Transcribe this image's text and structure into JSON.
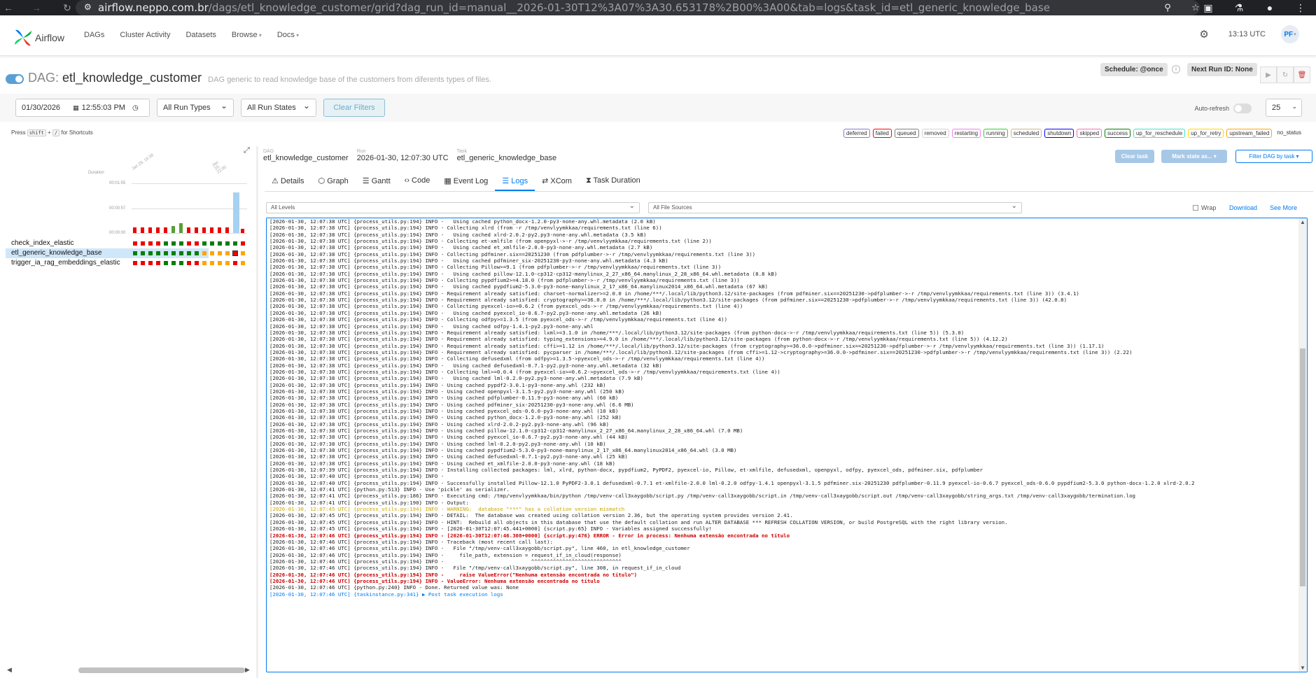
{
  "browser": {
    "url_host": "airflow.neppo.com.br",
    "url_path": "/dags/etl_knowledge_customer/grid?dag_run_id=manual__2026-01-30T12%3A07%3A30.653178%2B00%3A00&tab=logs&task_id=etl_generic_knowledge_base"
  },
  "app": {
    "logo": "Airflow",
    "menu": [
      "DAGs",
      "Cluster Activity",
      "Datasets",
      "Browse",
      "Docs"
    ],
    "time": "13:13 UTC",
    "user": "PF"
  },
  "dag": {
    "prefix": "DAG:",
    "name": "etl_knowledge_customer",
    "description": "DAG generic to read knowledge base of the customers from diferents types of files.",
    "schedule": "Schedule: @once",
    "next_run": "Next Run ID: None"
  },
  "filters": {
    "date": "01/30/2026",
    "time": "12:55:03 PM",
    "run_types": "All Run Types",
    "run_states": "All Run States",
    "clear": "Clear Filters",
    "auto_refresh": "Auto-refresh",
    "page_size": "25"
  },
  "shortcut": {
    "press": "Press",
    "key1": "shift",
    "key2": "/",
    "text": "for Shortcuts"
  },
  "legend": [
    {
      "label": "deferred",
      "color": "#9370db"
    },
    {
      "label": "failed",
      "color": "#ff0000"
    },
    {
      "label": "queued",
      "color": "#808080"
    },
    {
      "label": "removed",
      "color": "#d3d3d3"
    },
    {
      "label": "restarting",
      "color": "#ee82ee"
    },
    {
      "label": "running",
      "color": "#32cd32"
    },
    {
      "label": "scheduled",
      "color": "#d2b48c"
    },
    {
      "label": "shutdown",
      "color": "#0000ff"
    },
    {
      "label": "skipped",
      "color": "#ff69b4"
    },
    {
      "label": "success",
      "color": "#008000"
    },
    {
      "label": "up_for_reschedule",
      "color": "#40e0d0"
    },
    {
      "label": "up_for_retry",
      "color": "#ffd700"
    },
    {
      "label": "upstream_failed",
      "color": "#ffa500"
    },
    {
      "label": "no_status",
      "color": "#ffffff"
    }
  ],
  "grid": {
    "duration_label": "Duration",
    "yticks": [
      "00:01:55",
      "00:00:57",
      "00:00:00"
    ],
    "date_labels": [
      "Jan 28, 16:38",
      "Jan 29, 22:00"
    ],
    "tasks": [
      "check_index_elastic",
      "etl_generic_knowledge_base",
      "trigger_ia_rag_embeddings_elastic"
    ]
  },
  "detail": {
    "dag_label": "DAG",
    "dag_value": "etl_knowledge_customer",
    "run_label": "Run",
    "run_value": "2026-01-30, 12:07:30 UTC",
    "task_label": "Task",
    "task_value": "etl_generic_knowledge_base",
    "clear_task": "Clear task",
    "mark_state": "Mark state as...",
    "filter_dag": "Filter DAG by task",
    "tabs": [
      "Details",
      "Graph",
      "Gantt",
      "Code",
      "Event Log",
      "Logs",
      "XCom",
      "Task Duration"
    ],
    "tab_icons": [
      "warning-icon",
      "graph-icon",
      "gantt-icon",
      "code-icon",
      "calendar-icon",
      "list-icon",
      "xcom-icon",
      "hourglass-icon"
    ],
    "active_tab": "Logs",
    "levels": "All Levels",
    "sources": "All File Sources",
    "wrap": "Wrap",
    "download": "Download",
    "see_more": "See More"
  },
  "log_lines": [
    {
      "t": "[2026-01-30, 12:07:38 UTC] {process_utils.py:194} INFO -   Using cached python_docx-1.2.0-py3-none-any.whl.metadata (2.0 kB)",
      "c": ""
    },
    {
      "t": "[2026-01-30, 12:07:38 UTC] {process_utils.py:194} INFO - Collecting xlrd (from -r /tmp/venvlyymkkaa/requirements.txt (line 6))",
      "c": ""
    },
    {
      "t": "[2026-01-30, 12:07:38 UTC] {process_utils.py:194} INFO -   Using cached xlrd-2.0.2-py2.py3-none-any.whl.metadata (3.5 kB)",
      "c": ""
    },
    {
      "t": "[2026-01-30, 12:07:38 UTC] {process_utils.py:194} INFO - Collecting et-xmlfile (from openpyxl->-r /tmp/venvlyymkkaa/requirements.txt (line 2))",
      "c": ""
    },
    {
      "t": "[2026-01-30, 12:07:38 UTC] {process_utils.py:194} INFO -   Using cached et_xmlfile-2.0.0-py3-none-any.whl.metadata (2.7 kB)",
      "c": ""
    },
    {
      "t": "[2026-01-30, 12:07:38 UTC] {process_utils.py:194} INFO - Collecting pdfminer.six==20251230 (from pdfplumber->-r /tmp/venvlyymkkaa/requirements.txt (line 3))",
      "c": ""
    },
    {
      "t": "[2026-01-30, 12:07:38 UTC] {process_utils.py:194} INFO -   Using cached pdfminer_six-20251230-py3-none-any.whl.metadata (4.3 kB)",
      "c": ""
    },
    {
      "t": "[2026-01-30, 12:07:38 UTC] {process_utils.py:194} INFO - Collecting Pillow>=9.1 (from pdfplumber->-r /tmp/venvlyymkkaa/requirements.txt (line 3))",
      "c": ""
    },
    {
      "t": "[2026-01-30, 12:07:38 UTC] {process_utils.py:194} INFO -   Using cached pillow-12.1.0-cp312-cp312-manylinux_2_27_x86_64.manylinux_2_28_x86_64.whl.metadata (8.8 kB)",
      "c": ""
    },
    {
      "t": "[2026-01-30, 12:07:38 UTC] {process_utils.py:194} INFO - Collecting pypdfium2>=4.18.0 (from pdfplumber->-r /tmp/venvlyymkkaa/requirements.txt (line 3))",
      "c": ""
    },
    {
      "t": "[2026-01-30, 12:07:38 UTC] {process_utils.py:194} INFO -   Using cached pypdfium2-5.3.0-py3-none-manylinux_2_17_x86_64.manylinux2014_x86_64.whl.metadata (67 kB)",
      "c": ""
    },
    {
      "t": "[2026-01-30, 12:07:38 UTC] {process_utils.py:194} INFO - Requirement already satisfied: charset-normalizer>=2.0.0 in /home/***/.local/lib/python3.12/site-packages (from pdfminer.six==20251230->pdfplumber->-r /tmp/venvlyymkkaa/requirements.txt (line 3)) (3.4.1)",
      "c": ""
    },
    {
      "t": "[2026-01-30, 12:07:38 UTC] {process_utils.py:194} INFO - Requirement already satisfied: cryptography>=36.0.0 in /home/***/.local/lib/python3.12/site-packages (from pdfminer.six==20251230->pdfplumber->-r /tmp/venvlyymkkaa/requirements.txt (line 3)) (42.0.8)",
      "c": ""
    },
    {
      "t": "[2026-01-30, 12:07:38 UTC] {process_utils.py:194} INFO - Collecting pyexcel-io>=0.6.2 (from pyexcel_ods->-r /tmp/venvlyymkkaa/requirements.txt (line 4))",
      "c": ""
    },
    {
      "t": "[2026-01-30, 12:07:38 UTC] {process_utils.py:194} INFO -   Using cached pyexcel_io-0.6.7-py2.py3-none-any.whl.metadata (26 kB)",
      "c": ""
    },
    {
      "t": "[2026-01-30, 12:07:38 UTC] {process_utils.py:194} INFO - Collecting odfpy>=1.3.5 (from pyexcel_ods->-r /tmp/venvlyymkkaa/requirements.txt (line 4))",
      "c": ""
    },
    {
      "t": "[2026-01-30, 12:07:38 UTC] {process_utils.py:194} INFO -   Using cached odfpy-1.4.1-py2.py3-none-any.whl",
      "c": ""
    },
    {
      "t": "[2026-01-30, 12:07:38 UTC] {process_utils.py:194} INFO - Requirement already satisfied: lxml>=3.1.0 in /home/***/.local/lib/python3.12/site-packages (from python-docx->-r /tmp/venvlyymkkaa/requirements.txt (line 5)) (5.3.0)",
      "c": ""
    },
    {
      "t": "[2026-01-30, 12:07:38 UTC] {process_utils.py:194} INFO - Requirement already satisfied: typing_extensions>=4.9.0 in /home/***/.local/lib/python3.12/site-packages (from python-docx->-r /tmp/venvlyymkkaa/requirements.txt (line 5)) (4.12.2)",
      "c": ""
    },
    {
      "t": "[2026-01-30, 12:07:38 UTC] {process_utils.py:194} INFO - Requirement already satisfied: cffi>=1.12 in /home/***/.local/lib/python3.12/site-packages (from cryptography>=36.0.0->pdfminer.six==20251230->pdfplumber->-r /tmp/venvlyymkkaa/requirements.txt (line 3)) (1.17.1)",
      "c": ""
    },
    {
      "t": "[2026-01-30, 12:07:38 UTC] {process_utils.py:194} INFO - Requirement already satisfied: pycparser in /home/***/.local/lib/python3.12/site-packages (from cffi>=1.12->cryptography>=36.0.0->pdfminer.six==20251230->pdfplumber->-r /tmp/venvlyymkkaa/requirements.txt (line 3)) (2.22)",
      "c": ""
    },
    {
      "t": "[2026-01-30, 12:07:38 UTC] {process_utils.py:194} INFO - Collecting defusedxml (from odfpy>=1.3.5->pyexcel_ods->-r /tmp/venvlyymkkaa/requirements.txt (line 4))",
      "c": ""
    },
    {
      "t": "[2026-01-30, 12:07:38 UTC] {process_utils.py:194} INFO -   Using cached defusedxml-0.7.1-py2.py3-none-any.whl.metadata (32 kB)",
      "c": ""
    },
    {
      "t": "[2026-01-30, 12:07:38 UTC] {process_utils.py:194} INFO - Collecting lml>=0.0.4 (from pyexcel-io>=0.6.2->pyexcel_ods->-r /tmp/venvlyymkkaa/requirements.txt (line 4))",
      "c": ""
    },
    {
      "t": "[2026-01-30, 12:07:38 UTC] {process_utils.py:194} INFO -   Using cached lml-0.2.0-py2.py3-none-any.whl.metadata (7.9 kB)",
      "c": ""
    },
    {
      "t": "[2026-01-30, 12:07:38 UTC] {process_utils.py:194} INFO - Using cached pypdf2-3.0.1-py3-none-any.whl (232 kB)",
      "c": ""
    },
    {
      "t": "[2026-01-30, 12:07:38 UTC] {process_utils.py:194} INFO - Using cached openpyxl-3.1.5-py2.py3-none-any.whl (250 kB)",
      "c": ""
    },
    {
      "t": "[2026-01-30, 12:07:38 UTC] {process_utils.py:194} INFO - Using cached pdfplumber-0.11.9-py3-none-any.whl (60 kB)",
      "c": ""
    },
    {
      "t": "[2026-01-30, 12:07:38 UTC] {process_utils.py:194} INFO - Using cached pdfminer_six-20251230-py3-none-any.whl (6.6 MB)",
      "c": ""
    },
    {
      "t": "[2026-01-30, 12:07:38 UTC] {process_utils.py:194} INFO - Using cached pyexcel_ods-0.6.0-py3-none-any.whl (10 kB)",
      "c": ""
    },
    {
      "t": "[2026-01-30, 12:07:38 UTC] {process_utils.py:194} INFO - Using cached python_docx-1.2.0-py3-none-any.whl (252 kB)",
      "c": ""
    },
    {
      "t": "[2026-01-30, 12:07:38 UTC] {process_utils.py:194} INFO - Using cached xlrd-2.0.2-py2.py3-none-any.whl (96 kB)",
      "c": ""
    },
    {
      "t": "[2026-01-30, 12:07:38 UTC] {process_utils.py:194} INFO - Using cached pillow-12.1.0-cp312-cp312-manylinux_2_27_x86_64.manylinux_2_28_x86_64.whl (7.0 MB)",
      "c": ""
    },
    {
      "t": "[2026-01-30, 12:07:38 UTC] {process_utils.py:194} INFO - Using cached pyexcel_io-0.6.7-py2.py3-none-any.whl (44 kB)",
      "c": ""
    },
    {
      "t": "[2026-01-30, 12:07:38 UTC] {process_utils.py:194} INFO - Using cached lml-0.2.0-py2.py3-none-any.whl (10 kB)",
      "c": ""
    },
    {
      "t": "[2026-01-30, 12:07:38 UTC] {process_utils.py:194} INFO - Using cached pypdfium2-5.3.0-py3-none-manylinux_2_17_x86_64.manylinux2014_x86_64.whl (3.0 MB)",
      "c": ""
    },
    {
      "t": "[2026-01-30, 12:07:38 UTC] {process_utils.py:194} INFO - Using cached defusedxml-0.7.1-py2.py3-none-any.whl (25 kB)",
      "c": ""
    },
    {
      "t": "[2026-01-30, 12:07:38 UTC] {process_utils.py:194} INFO - Using cached et_xmlfile-2.0.0-py3-none-any.whl (18 kB)",
      "c": ""
    },
    {
      "t": "[2026-01-30, 12:07:39 UTC] {process_utils.py:194} INFO - Installing collected packages: lml, xlrd, python-docx, pypdfium2, PyPDF2, pyexcel-io, Pillow, et-xmlfile, defusedxml, openpyxl, odfpy, pyexcel_ods, pdfminer.six, pdfplumber",
      "c": ""
    },
    {
      "t": "[2026-01-30, 12:07:40 UTC] {process_utils.py:194} INFO - ",
      "c": ""
    },
    {
      "t": "[2026-01-30, 12:07:40 UTC] {process_utils.py:194} INFO - Successfully installed Pillow-12.1.0 PyPDF2-3.0.1 defusedxml-0.7.1 et-xmlfile-2.0.0 lml-0.2.0 odfpy-1.4.1 openpyxl-3.1.5 pdfminer.six-20251230 pdfplumber-0.11.9 pyexcel-io-0.6.7 pyexcel_ods-0.6.0 pypdfium2-5.3.0 python-docx-1.2.0 xlrd-2.0.2",
      "c": ""
    },
    {
      "t": "[2026-01-30, 12:07:41 UTC] {python.py:513} INFO - Use 'pickle' as serializer.",
      "c": ""
    },
    {
      "t": "[2026-01-30, 12:07:41 UTC] {process_utils.py:186} INFO - Executing cmd: /tmp/venvlyymkkaa/bin/python /tmp/venv-call3xaygobb/script.py /tmp/venv-call3xaygobb/script.in /tmp/venv-call3xaygobb/script.out /tmp/venv-call3xaygobb/string_args.txt /tmp/venv-call3xaygobb/termination.log",
      "c": ""
    },
    {
      "t": "[2026-01-30, 12:07:41 UTC] {process_utils.py:190} INFO - Output:",
      "c": ""
    },
    {
      "t": "[2026-01-30, 12:07:45 UTC] {process_utils.py:194} INFO - WARNING:  database \"***\" has a collation version mismatch",
      "c": "warn"
    },
    {
      "t": "[2026-01-30, 12:07:45 UTC] {process_utils.py:194} INFO - DETAIL:  The database was created using collation version 2.36, but the operating system provides version 2.41.",
      "c": ""
    },
    {
      "t": "[2026-01-30, 12:07:45 UTC] {process_utils.py:194} INFO - HINT:  Rebuild all objects in this database that use the default collation and run ALTER DATABASE *** REFRESH COLLATION VERSION, or build PostgreSQL with the right library version.",
      "c": ""
    },
    {
      "t": "[2026-01-30, 12:07:45 UTC] {process_utils.py:194} INFO - [2026-01-30T12:07:45.441+0000] {script.py:65} INFO - Variables assigned successfully!",
      "c": ""
    },
    {
      "t": "[2026-01-30, 12:07:46 UTC] {process_utils.py:194} INFO - [2026-01-30T12:07:46.308+0000] {script.py:476} ERROR - Error in process: Nenhuma extensão encontrada no título",
      "c": "err"
    },
    {
      "t": "[2026-01-30, 12:07:46 UTC] {process_utils.py:194} INFO - Traceback (most recent call last):",
      "c": ""
    },
    {
      "t": "[2026-01-30, 12:07:46 UTC] {process_utils.py:194} INFO -   File \"/tmp/venv-call3xaygobb/script.py\", line 460, in etl_knowledge_customer",
      "c": ""
    },
    {
      "t": "[2026-01-30, 12:07:46 UTC] {process_utils.py:194} INFO -     file_path, extension = request_if_in_cloud(response)",
      "c": ""
    },
    {
      "t": "[2026-01-30, 12:07:46 UTC] {process_utils.py:194} INFO -                            ^^^^^^^^^^^^^^^^^^^^^^^^^^^^^",
      "c": ""
    },
    {
      "t": "[2026-01-30, 12:07:46 UTC] {process_utils.py:194} INFO -   File \"/tmp/venv-call3xaygobb/script.py\", line 308, in request_if_in_cloud",
      "c": ""
    },
    {
      "t": "[2026-01-30, 12:07:46 UTC] {process_utils.py:194} INFO -     raise ValueError(\"Nenhuma extensão encontrada no título\")",
      "c": "err"
    },
    {
      "t": "[2026-01-30, 12:07:46 UTC] {process_utils.py:194} INFO - ValueError: Nenhuma extensão encontrada no título",
      "c": "err"
    },
    {
      "t": "[2026-01-30, 12:07:46 UTC] {python.py:240} INFO - Done. Returned value was: None",
      "c": ""
    },
    {
      "t": "[2026-01-30, 12:07:46 UTC] {taskinstance.py:341} ▶ Post task execution logs",
      "c": "blue"
    }
  ]
}
